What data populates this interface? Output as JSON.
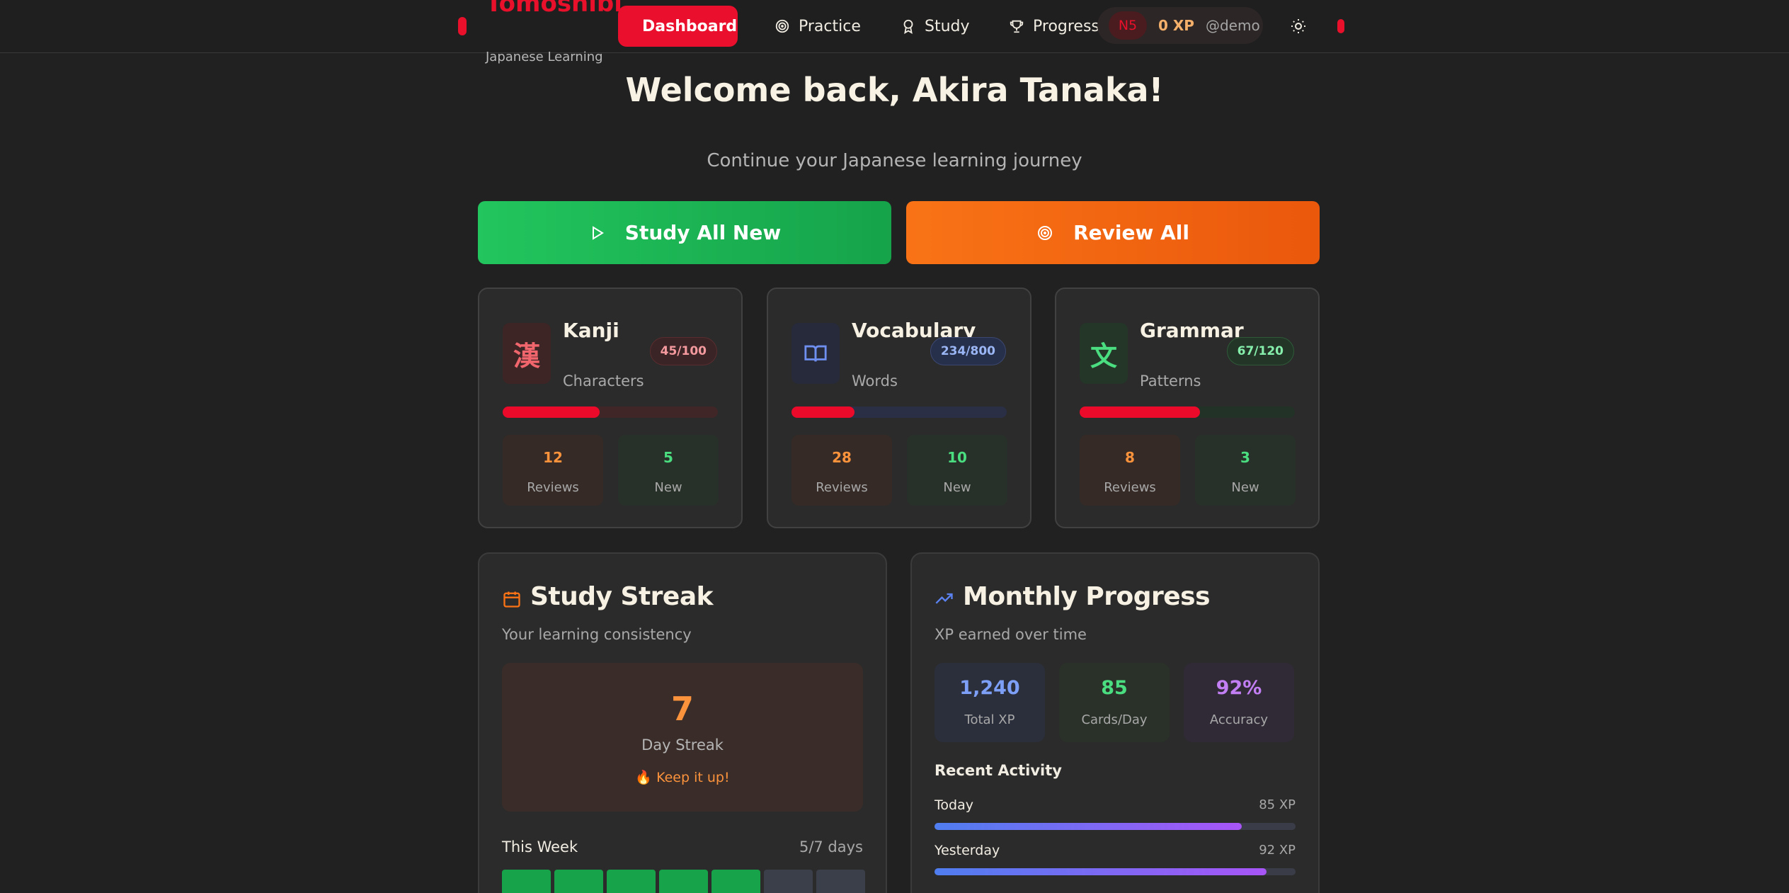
{
  "header": {
    "brand_title": "Tomoshibi",
    "brand_subtitle": "Japanese Learning",
    "nav": [
      {
        "label": "Dashboard",
        "icon": "home-icon",
        "active": true
      },
      {
        "label": "Practice",
        "icon": "target-icon",
        "active": false
      },
      {
        "label": "Study",
        "icon": "award-icon",
        "active": false
      },
      {
        "label": "Progress",
        "icon": "trophy-icon",
        "active": false
      }
    ],
    "user": {
      "level": "N5",
      "xp": "0 XP",
      "handle": "@demo"
    },
    "theme_icon": "sun-icon"
  },
  "hero": {
    "welcome": "Welcome back, Akira Tanaka!",
    "subtitle": "Continue your Japanese learning journey",
    "study_all": "Study All New",
    "review_all": "Review All"
  },
  "categories": [
    {
      "title": "Kanji",
      "subtitle": "Characters",
      "glyph": "漢",
      "badge": "45/100",
      "progress": 0.45,
      "reviews": "12",
      "reviews_label": "Reviews",
      "new": "5",
      "new_label": "New"
    },
    {
      "title": "Vocabulary",
      "subtitle": "Words",
      "glyph": "book-icon",
      "badge": "234/800",
      "progress": 0.2925,
      "reviews": "28",
      "reviews_label": "Reviews",
      "new": "10",
      "new_label": "New"
    },
    {
      "title": "Grammar",
      "subtitle": "Patterns",
      "glyph": "文",
      "badge": "67/120",
      "progress": 0.558,
      "reviews": "8",
      "reviews_label": "Reviews",
      "new": "3",
      "new_label": "New"
    }
  ],
  "streak": {
    "title": "Study Streak",
    "subtitle": "Your learning consistency",
    "days": "7",
    "days_label": "Day Streak",
    "message": "🔥 Keep it up!",
    "week_label": "This Week",
    "week_value": "5/7 days",
    "week": [
      true,
      true,
      true,
      true,
      true,
      false,
      false
    ]
  },
  "monthly": {
    "title": "Monthly Progress",
    "subtitle": "XP earned over time",
    "total_xp": "1,240",
    "total_xp_label": "Total XP",
    "cards_per_day": "85",
    "cards_per_day_label": "Cards/Day",
    "accuracy": "92%",
    "accuracy_label": "Accuracy",
    "recent_title": "Recent Activity",
    "activity": [
      {
        "label": "Today",
        "value": "85 XP",
        "progress": 0.85
      },
      {
        "label": "Yesterday",
        "value": "92 XP",
        "progress": 0.92
      }
    ]
  },
  "colors": {
    "accent": "#e8102a",
    "green": "#16a34a",
    "orange": "#f97316"
  }
}
